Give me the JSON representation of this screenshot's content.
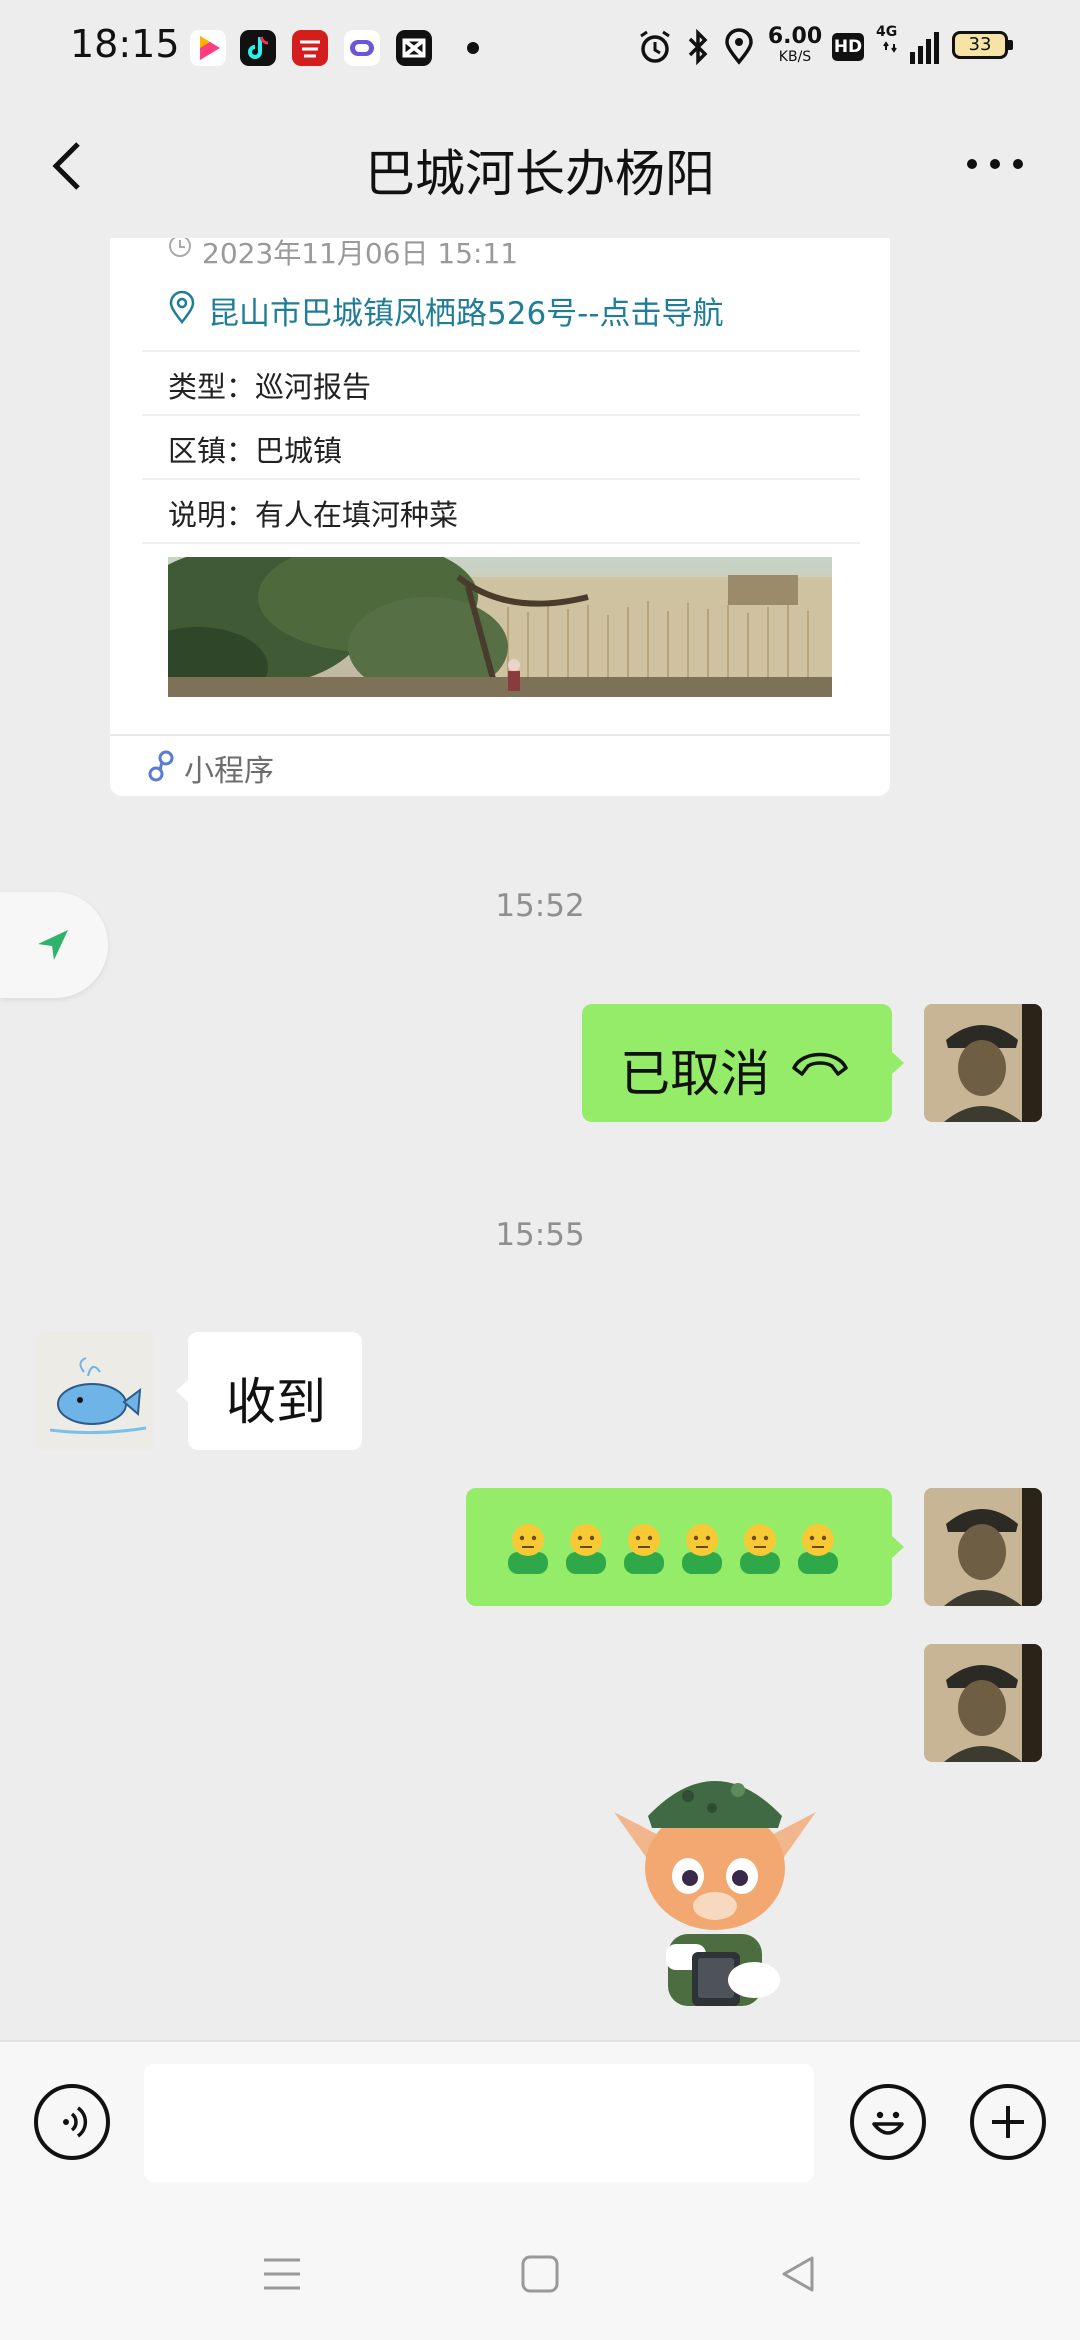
{
  "status_bar": {
    "time": "18:15",
    "speed": "6.00",
    "speed_unit": "KB/S",
    "hd": "HD",
    "network": "4G",
    "battery": "33"
  },
  "header": {
    "title": "巴城河长办杨阳",
    "back_icon": "chevron-left-icon",
    "more_icon": "more-dots-icon"
  },
  "card": {
    "datetime": "2023年11月06日 15:11",
    "address": "昆山市巴城镇凤栖路526号--点击导航",
    "rows": [
      {
        "label": "类型：",
        "value": "巡河报告"
      },
      {
        "label": "区镇：",
        "value": "巴城镇"
      },
      {
        "label": "说明：",
        "value": "有人在填河种菜"
      }
    ],
    "footer_label": "小程序"
  },
  "messages": {
    "ts1": "15:52",
    "cancelled": "已取消",
    "ts2": "15:55",
    "received": "收到"
  },
  "colors": {
    "chat_bg": "#ededed",
    "sent_bubble": "#95ec69",
    "link_teal": "#1f7d98"
  }
}
